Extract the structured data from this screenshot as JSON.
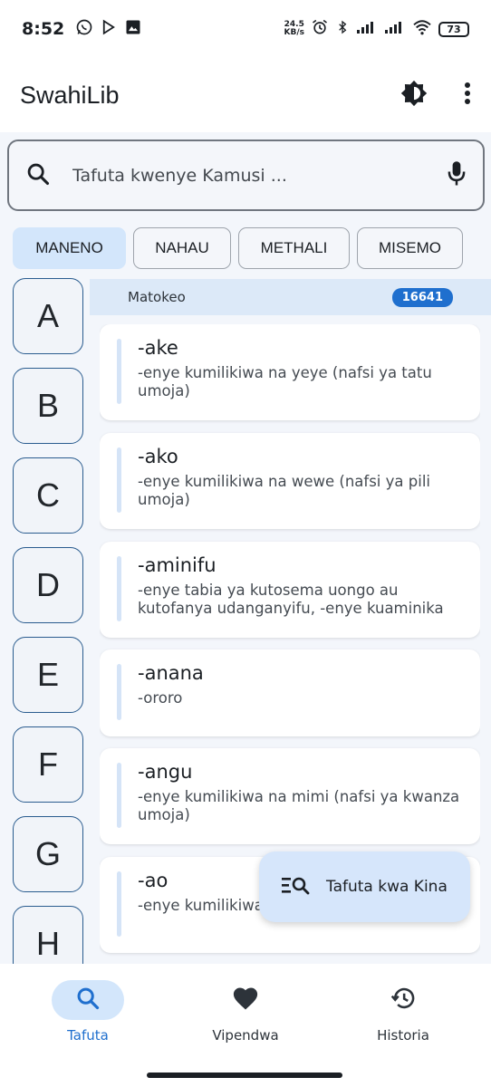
{
  "status": {
    "time": "8:52",
    "netspeed_value": "24.5",
    "netspeed_unit": "KB/s",
    "battery": "73"
  },
  "app": {
    "title": "SwahiLib"
  },
  "search": {
    "placeholder": "Tafuta kwenye Kamusi ..."
  },
  "chips": [
    {
      "label": "MANENO",
      "active": true
    },
    {
      "label": "NAHAU",
      "active": false
    },
    {
      "label": "METHALI",
      "active": false
    },
    {
      "label": "MISEMO",
      "active": false
    }
  ],
  "letters": [
    "A",
    "B",
    "C",
    "D",
    "E",
    "F",
    "G",
    "H"
  ],
  "results": {
    "label": "Matokeo",
    "count": "16641"
  },
  "entries": [
    {
      "word": "-ake",
      "meaning": "-enye kumilikiwa na yeye (nafsi ya tatu umoja)"
    },
    {
      "word": "-ako",
      "meaning": "-enye kumilikiwa na wewe (nafsi ya pili umoja)"
    },
    {
      "word": "-aminifu",
      "meaning": "-enye tabia ya kutosema uongo au kutofanya udanganyifu, -enye kuaminika"
    },
    {
      "word": "-anana",
      "meaning": "-ororo"
    },
    {
      "word": "-angu",
      "meaning": "-enye kumilikiwa na mimi (nafsi ya kwanza umoja)"
    },
    {
      "word": "-ao",
      "meaning": "-enye kumilikiwa ... wingi)"
    }
  ],
  "fab": {
    "label": "Tafuta kwa Kina"
  },
  "nav": [
    {
      "label": "Tafuta",
      "icon": "search-icon",
      "active": true
    },
    {
      "label": "Vipendwa",
      "icon": "heart-icon",
      "active": false
    },
    {
      "label": "Historia",
      "icon": "history-icon",
      "active": false
    }
  ],
  "colors": {
    "accent": "#1f6fce",
    "chip_active": "#d3e6fb",
    "results_bar": "#dce9f8"
  }
}
